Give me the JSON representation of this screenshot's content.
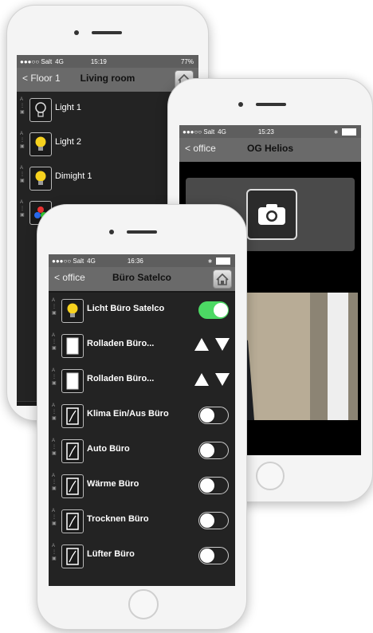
{
  "phone1": {
    "status": {
      "carrier": "●●●○○ Salt",
      "network": "4G",
      "time": "15:19",
      "battery": "77%"
    },
    "nav": {
      "back": "< Floor 1",
      "title": "Living room"
    },
    "rows": [
      {
        "label": "Light 1",
        "icon": "bulb-off-icon"
      },
      {
        "label": "Light 2",
        "icon": "bulb-on-icon"
      },
      {
        "label": "Dimight 1",
        "icon": "bulb-on-icon"
      },
      {
        "label": "",
        "icon": "rgb-icon"
      }
    ]
  },
  "phone2": {
    "status": {
      "carrier": "●●●○○ Salt",
      "network": "4G",
      "time": "15:23"
    },
    "nav": {
      "back": "< office",
      "title": "OG Helios"
    }
  },
  "phone3": {
    "status": {
      "carrier": "●●●○○ Salt",
      "network": "4G",
      "time": "16:36"
    },
    "nav": {
      "back": "< office",
      "title": "Büro Satelco"
    },
    "rows": [
      {
        "label": "Licht Büro Satelco",
        "icon": "bulb-on-icon",
        "control": "toggle",
        "on": true
      },
      {
        "label": "Rolladen Büro...",
        "icon": "blind-icon",
        "control": "arrows"
      },
      {
        "label": "Rolladen Büro...",
        "icon": "blind-icon",
        "control": "arrows"
      },
      {
        "label": "Klima Ein/Aus Büro",
        "icon": "window-icon",
        "control": "toggle",
        "on": false
      },
      {
        "label": "Auto Büro",
        "icon": "window-icon",
        "control": "toggle",
        "on": false
      },
      {
        "label": "Wärme Büro",
        "icon": "window-icon",
        "control": "toggle",
        "on": false
      },
      {
        "label": "Trocknen Büro",
        "icon": "window-icon",
        "control": "toggle",
        "on": false
      },
      {
        "label": "Lüfter Büro",
        "icon": "window-icon",
        "control": "toggle",
        "on": false
      }
    ]
  },
  "colors": {
    "accent_green": "#4cd964",
    "bulb_yellow": "#f7d21e",
    "nav_gray": "#6a6a6a"
  }
}
